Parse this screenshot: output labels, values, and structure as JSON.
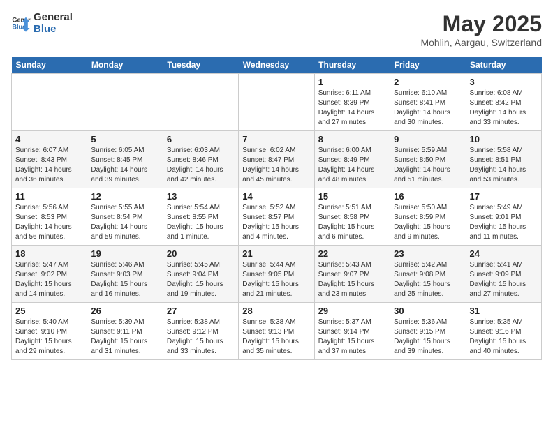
{
  "header": {
    "logo_line1": "General",
    "logo_line2": "Blue",
    "month_title": "May 2025",
    "location": "Mohlin, Aargau, Switzerland"
  },
  "weekdays": [
    "Sunday",
    "Monday",
    "Tuesday",
    "Wednesday",
    "Thursday",
    "Friday",
    "Saturday"
  ],
  "weeks": [
    [
      {
        "day": "",
        "info": ""
      },
      {
        "day": "",
        "info": ""
      },
      {
        "day": "",
        "info": ""
      },
      {
        "day": "",
        "info": ""
      },
      {
        "day": "1",
        "info": "Sunrise: 6:11 AM\nSunset: 8:39 PM\nDaylight: 14 hours\nand 27 minutes."
      },
      {
        "day": "2",
        "info": "Sunrise: 6:10 AM\nSunset: 8:41 PM\nDaylight: 14 hours\nand 30 minutes."
      },
      {
        "day": "3",
        "info": "Sunrise: 6:08 AM\nSunset: 8:42 PM\nDaylight: 14 hours\nand 33 minutes."
      }
    ],
    [
      {
        "day": "4",
        "info": "Sunrise: 6:07 AM\nSunset: 8:43 PM\nDaylight: 14 hours\nand 36 minutes."
      },
      {
        "day": "5",
        "info": "Sunrise: 6:05 AM\nSunset: 8:45 PM\nDaylight: 14 hours\nand 39 minutes."
      },
      {
        "day": "6",
        "info": "Sunrise: 6:03 AM\nSunset: 8:46 PM\nDaylight: 14 hours\nand 42 minutes."
      },
      {
        "day": "7",
        "info": "Sunrise: 6:02 AM\nSunset: 8:47 PM\nDaylight: 14 hours\nand 45 minutes."
      },
      {
        "day": "8",
        "info": "Sunrise: 6:00 AM\nSunset: 8:49 PM\nDaylight: 14 hours\nand 48 minutes."
      },
      {
        "day": "9",
        "info": "Sunrise: 5:59 AM\nSunset: 8:50 PM\nDaylight: 14 hours\nand 51 minutes."
      },
      {
        "day": "10",
        "info": "Sunrise: 5:58 AM\nSunset: 8:51 PM\nDaylight: 14 hours\nand 53 minutes."
      }
    ],
    [
      {
        "day": "11",
        "info": "Sunrise: 5:56 AM\nSunset: 8:53 PM\nDaylight: 14 hours\nand 56 minutes."
      },
      {
        "day": "12",
        "info": "Sunrise: 5:55 AM\nSunset: 8:54 PM\nDaylight: 14 hours\nand 59 minutes."
      },
      {
        "day": "13",
        "info": "Sunrise: 5:54 AM\nSunset: 8:55 PM\nDaylight: 15 hours\nand 1 minute."
      },
      {
        "day": "14",
        "info": "Sunrise: 5:52 AM\nSunset: 8:57 PM\nDaylight: 15 hours\nand 4 minutes."
      },
      {
        "day": "15",
        "info": "Sunrise: 5:51 AM\nSunset: 8:58 PM\nDaylight: 15 hours\nand 6 minutes."
      },
      {
        "day": "16",
        "info": "Sunrise: 5:50 AM\nSunset: 8:59 PM\nDaylight: 15 hours\nand 9 minutes."
      },
      {
        "day": "17",
        "info": "Sunrise: 5:49 AM\nSunset: 9:01 PM\nDaylight: 15 hours\nand 11 minutes."
      }
    ],
    [
      {
        "day": "18",
        "info": "Sunrise: 5:47 AM\nSunset: 9:02 PM\nDaylight: 15 hours\nand 14 minutes."
      },
      {
        "day": "19",
        "info": "Sunrise: 5:46 AM\nSunset: 9:03 PM\nDaylight: 15 hours\nand 16 minutes."
      },
      {
        "day": "20",
        "info": "Sunrise: 5:45 AM\nSunset: 9:04 PM\nDaylight: 15 hours\nand 19 minutes."
      },
      {
        "day": "21",
        "info": "Sunrise: 5:44 AM\nSunset: 9:05 PM\nDaylight: 15 hours\nand 21 minutes."
      },
      {
        "day": "22",
        "info": "Sunrise: 5:43 AM\nSunset: 9:07 PM\nDaylight: 15 hours\nand 23 minutes."
      },
      {
        "day": "23",
        "info": "Sunrise: 5:42 AM\nSunset: 9:08 PM\nDaylight: 15 hours\nand 25 minutes."
      },
      {
        "day": "24",
        "info": "Sunrise: 5:41 AM\nSunset: 9:09 PM\nDaylight: 15 hours\nand 27 minutes."
      }
    ],
    [
      {
        "day": "25",
        "info": "Sunrise: 5:40 AM\nSunset: 9:10 PM\nDaylight: 15 hours\nand 29 minutes."
      },
      {
        "day": "26",
        "info": "Sunrise: 5:39 AM\nSunset: 9:11 PM\nDaylight: 15 hours\nand 31 minutes."
      },
      {
        "day": "27",
        "info": "Sunrise: 5:38 AM\nSunset: 9:12 PM\nDaylight: 15 hours\nand 33 minutes."
      },
      {
        "day": "28",
        "info": "Sunrise: 5:38 AM\nSunset: 9:13 PM\nDaylight: 15 hours\nand 35 minutes."
      },
      {
        "day": "29",
        "info": "Sunrise: 5:37 AM\nSunset: 9:14 PM\nDaylight: 15 hours\nand 37 minutes."
      },
      {
        "day": "30",
        "info": "Sunrise: 5:36 AM\nSunset: 9:15 PM\nDaylight: 15 hours\nand 39 minutes."
      },
      {
        "day": "31",
        "info": "Sunrise: 5:35 AM\nSunset: 9:16 PM\nDaylight: 15 hours\nand 40 minutes."
      }
    ]
  ]
}
